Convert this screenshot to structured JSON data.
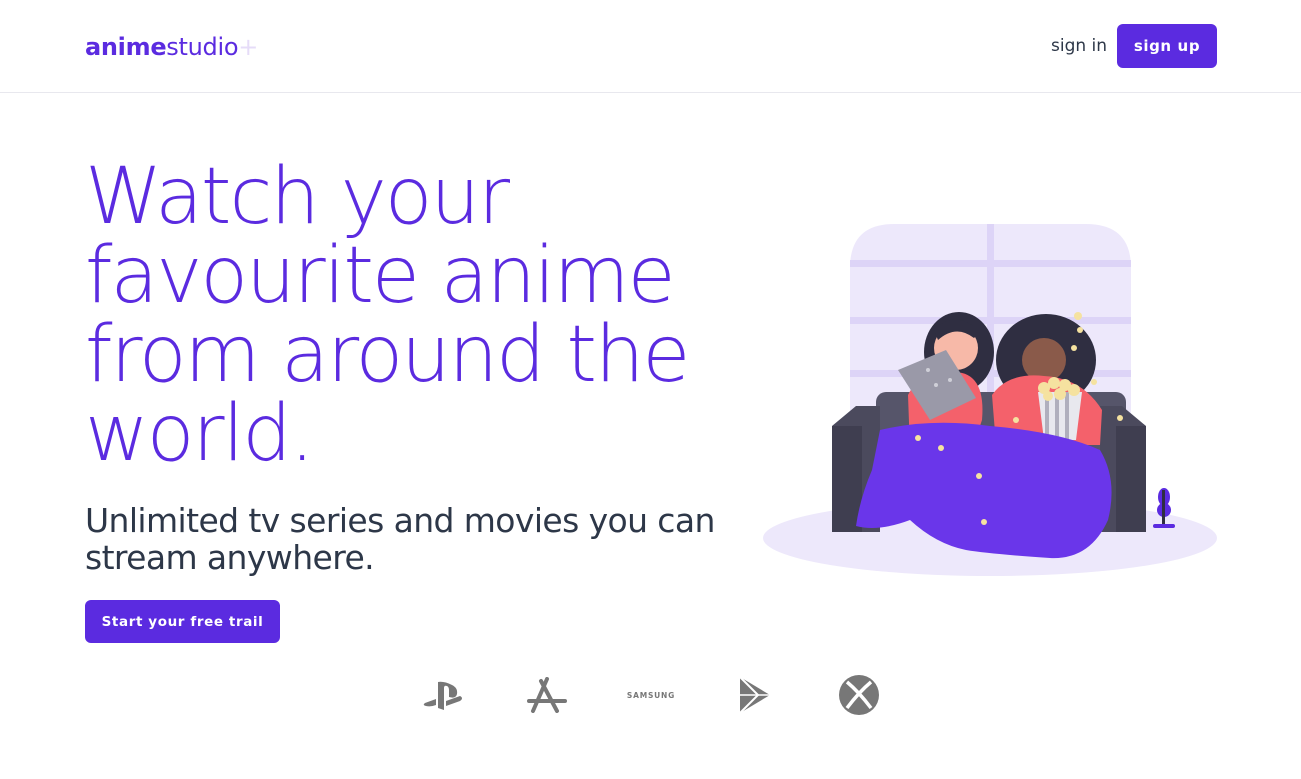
{
  "header": {
    "logo": {
      "part1": "anime",
      "part2": "studio",
      "part3": "+"
    },
    "signin_label": "sign in",
    "signup_label": "sign up"
  },
  "hero": {
    "title": "Watch your favourite anime from around the world.",
    "subtitle": "Unlimited tv series and movies you can stream anywhere.",
    "cta_label": "Start your free trail"
  },
  "platforms": [
    {
      "icon": "playstation-icon"
    },
    {
      "icon": "app-store-icon"
    },
    {
      "icon": "samsung-icon",
      "text": "SAMSUNG"
    },
    {
      "icon": "google-play-icon"
    },
    {
      "icon": "xbox-icon"
    }
  ],
  "colors": {
    "brand": "#5b2be0",
    "text": "#2d3748",
    "illustration_bg": "#ede8fb",
    "couch": "#4b4a5d",
    "blanket": "#6a36ea",
    "icon_gray": "#777777"
  }
}
